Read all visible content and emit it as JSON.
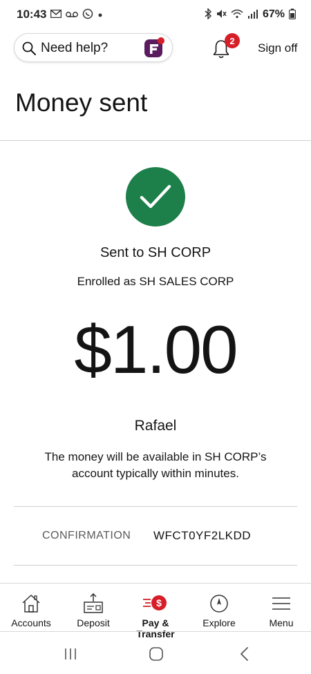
{
  "status_bar": {
    "time": "10:43",
    "left_icons": [
      "gmail-icon",
      "voicemail-icon",
      "whatsapp-icon",
      "dot-icon"
    ],
    "right_icons": [
      "bluetooth-icon",
      "mute-icon",
      "wifi-icon",
      "signal-icon"
    ],
    "battery": "67%"
  },
  "header": {
    "search_placeholder": "Need help?",
    "notification_count": "2",
    "sign_off_label": "Sign off"
  },
  "page": {
    "title": "Money sent",
    "sent_to": "Sent to SH CORP",
    "enrolled_as": "Enrolled as SH SALES CORP",
    "amount": "$1.00",
    "recipient_name": "Rafael",
    "availability_message": "The money will be available in SH CORP’s account typically within minutes.",
    "confirmation_label": "CONFIRMATION",
    "confirmation_number": "WFCT0YF2LKDD"
  },
  "bottom_nav": {
    "items": [
      {
        "label": "Accounts",
        "icon": "house-icon"
      },
      {
        "label": "Deposit",
        "icon": "deposit-icon"
      },
      {
        "label": "Pay & Transfer",
        "icon": "pay-transfer-icon",
        "active": true
      },
      {
        "label": "Explore",
        "icon": "compass-icon"
      },
      {
        "label": "Menu",
        "icon": "hamburger-icon"
      }
    ]
  },
  "colors": {
    "success_green": "#1d7f4a",
    "brand_red": "#d71e28",
    "fargo_purple": "#5a1c5f"
  }
}
